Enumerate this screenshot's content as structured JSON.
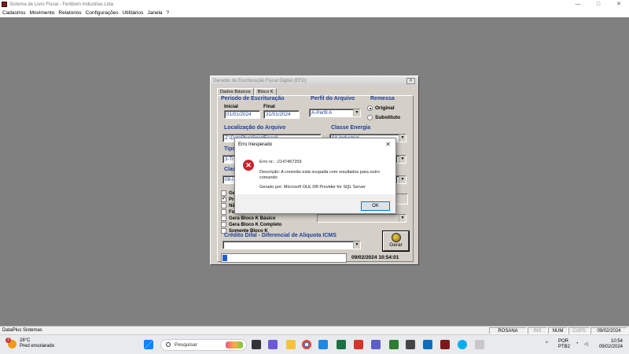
{
  "window": {
    "title": "Sistema de Livro Fiscal - Fertibom Industrias Ltda",
    "min": "—",
    "max": "□",
    "close": "✕"
  },
  "menu": [
    "Cadastros",
    "Movimento",
    "Relatorios",
    "Configurações",
    "Utilitários",
    "Janela",
    "?"
  ],
  "efd": {
    "title": "Gerador de Escrituração Fiscal Digital (EFD)",
    "tabs": [
      "Dados Básicos",
      "Bloco K"
    ],
    "periodo": {
      "title": "Período de Escrituração",
      "inicial_label": "Inicial",
      "inicial": "01/01/2024",
      "final_label": "Final",
      "final": "31/01/2024"
    },
    "perfil": {
      "title": "Perfil do Arquivo",
      "value": "A-Perfil A"
    },
    "remessa": {
      "title": "Remessa",
      "original": "Original",
      "substituto": "Substituto",
      "selected": "Original"
    },
    "localizacao": {
      "title": "Localização do Arquivo",
      "value": "Z:\\DataPlus\\SpedFiscal\\"
    },
    "classe_energia": {
      "title": "Classe Energia",
      "value": "04-Industrial"
    },
    "tipo": {
      "title": "Tipo",
      "value": "3-Tr"
    },
    "classe": {
      "title": "Clas",
      "value": "08-I"
    },
    "checks": [
      {
        "label": "Ger",
        "checked": false
      },
      {
        "label": "Pro",
        "checked": true
      },
      {
        "label": "Não",
        "checked": false
      },
      {
        "label": "For",
        "checked": false
      },
      {
        "label": "Gera Bloco K Básico",
        "checked": false
      },
      {
        "label": "Gera Bloco K Completo",
        "checked": false
      },
      {
        "label": "Somente Bloco K",
        "checked": false
      }
    ],
    "difal": {
      "title": "Crédito Difal - Diferencial de Aliquota ICMS",
      "value": ""
    },
    "gerar": "Gerar",
    "progress": 0.04,
    "datetime": "09/02/2024 10:54:01"
  },
  "error": {
    "title": "Erro Inesperado",
    "code_line": "Erro nr.: -2147467259",
    "desc_line": "Descrição: A conexão está ocupada com resultados para outro comando",
    "source_line": "Gerado por: Microsoft OLE DB Provider for SQL Server",
    "ok": "OK"
  },
  "status": {
    "left": "DataPlus Sistemas",
    "cells": [
      "ROSANA",
      "INS",
      "NUM",
      "CAPS",
      "09/02/2024"
    ]
  },
  "taskbar": {
    "weather_badge": "1",
    "temp": "28°C",
    "condition": "Pred ensolarado",
    "search": "Pesquisar",
    "lang1": "POR",
    "lang2": "PTB2",
    "time": "10:54",
    "date": "09/02/2024",
    "tray_arrow": "^"
  }
}
